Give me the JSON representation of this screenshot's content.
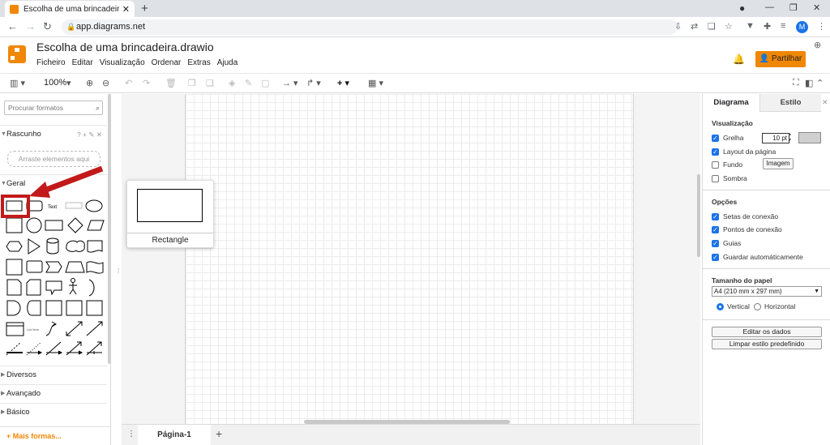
{
  "browser": {
    "tab_title": "Escolha de uma brincadeira.draw",
    "url": "app.diagrams.net",
    "avatar_letter": "M"
  },
  "app": {
    "title": "Escolha de uma brincadeira.drawio",
    "menu": [
      "Ficheiro",
      "Editar",
      "Visualização",
      "Ordenar",
      "Extras",
      "Ajuda"
    ],
    "share_label": "Partilhar",
    "brand_color": "#f08705"
  },
  "toolbar": {
    "zoom": "100%"
  },
  "sidebar": {
    "search_placeholder": "Procurar formatos",
    "scratchpad": "Rascunho",
    "dropzone": "Arraste elementos aqui",
    "general": "Geral",
    "sections": [
      "Diversos",
      "Avançado",
      "Básico"
    ],
    "more_shapes": "+ Mais formas...",
    "shape_text_label": "Text",
    "shape_list_label": "List Item"
  },
  "canvas": {
    "tooltip_label": "Rectangle",
    "page_tab": "Página-1"
  },
  "format_panel": {
    "tabs": [
      "Diagrama",
      "Estilo"
    ],
    "view_header": "Visualização",
    "grid": {
      "label": "Grelha",
      "checked": true,
      "size": "10 pt"
    },
    "page_view": {
      "label": "Layout da página",
      "checked": true
    },
    "background": {
      "label": "Fundo",
      "checked": false,
      "button": "Imagem"
    },
    "shadow": {
      "label": "Sombra",
      "checked": false
    },
    "options_header": "Opções",
    "options": [
      {
        "label": "Setas de conexão",
        "checked": true
      },
      {
        "label": "Pontos de conexão",
        "checked": true
      },
      {
        "label": "Guias",
        "checked": true
      },
      {
        "label": "Guardar automáticamente",
        "checked": true
      }
    ],
    "paper_header": "Tamanho do papel",
    "paper_size": "A4 (210 mm x 297 mm)",
    "orientation": {
      "vertical": "Vertical",
      "horizontal": "Horizontal",
      "selected": "vertical"
    },
    "edit_data": "Editar os dados",
    "clear_style": "Limpar estilo predefinido"
  }
}
